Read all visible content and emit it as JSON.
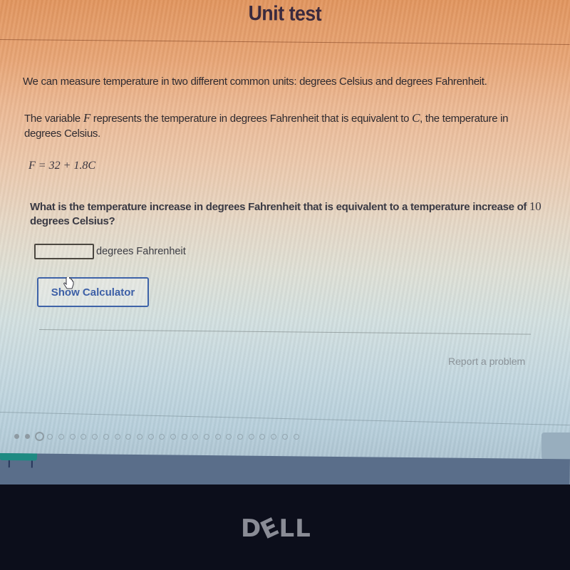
{
  "header": {
    "title": "Unit test"
  },
  "problem": {
    "intro": "We can measure temperature in two different common units: degrees Celsius and degrees Fahrenheit.",
    "definition": {
      "before_var_f": "The variable ",
      "var_f": "F",
      "middle": " represents the temperature in degrees Fahrenheit that is equivalent to ",
      "var_c": "C",
      "after": ", the temperature in degrees Celsius."
    },
    "formula": "F = 32 + 1.8C",
    "question_text": "What is the temperature increase in degrees Fahrenheit that is equivalent to a temperature increase of ",
    "question_value": "10",
    "question_end": " degrees Celsius?"
  },
  "answer": {
    "value": "",
    "unit_label": "degrees Fahrenheit"
  },
  "buttons": {
    "calculator": "Show Calculator"
  },
  "footer": {
    "report_link": "Report a problem"
  },
  "progress": {
    "total_questions": 26,
    "completed": 2,
    "current": 3
  },
  "hardware": {
    "brand_logo": "DELL"
  },
  "colors": {
    "title": "#3a2a3e",
    "button_accent": "#3c5fa6",
    "taskbar": "#5a6e8a",
    "taskbar_active": "#1e8a82"
  }
}
